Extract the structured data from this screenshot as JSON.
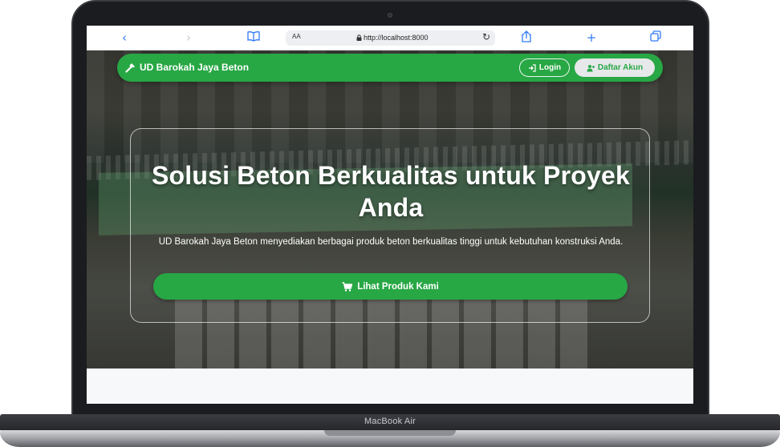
{
  "device": {
    "model_label": "MacBook Air"
  },
  "browser": {
    "url": "http://localhost:8000",
    "text_size_label": "AA",
    "icons": [
      "back-icon",
      "forward-icon",
      "bookmarks-icon",
      "lock-icon",
      "reload-icon",
      "share-icon",
      "new-tab-icon",
      "tabs-icon"
    ]
  },
  "navbar": {
    "brand": "UD Barokah Jaya Beton",
    "brand_icon": "hammer-icon",
    "login_label": "Login",
    "login_icon": "sign-in-icon",
    "register_label": "Daftar Akun",
    "register_icon": "user-plus-icon"
  },
  "hero": {
    "title": "Solusi Beton Berkualitas untuk Proyek Anda",
    "description": "UD Barokah Jaya Beton menyediakan berbagai produk beton berkualitas tinggi untuk kebutuhan konstruksi Anda.",
    "cta_label": "Lihat Produk Kami",
    "cta_icon": "cart-icon"
  },
  "colors": {
    "primary": "#28a745",
    "browser_accent": "#2f7af5",
    "register_bg": "#e6e8ea"
  }
}
